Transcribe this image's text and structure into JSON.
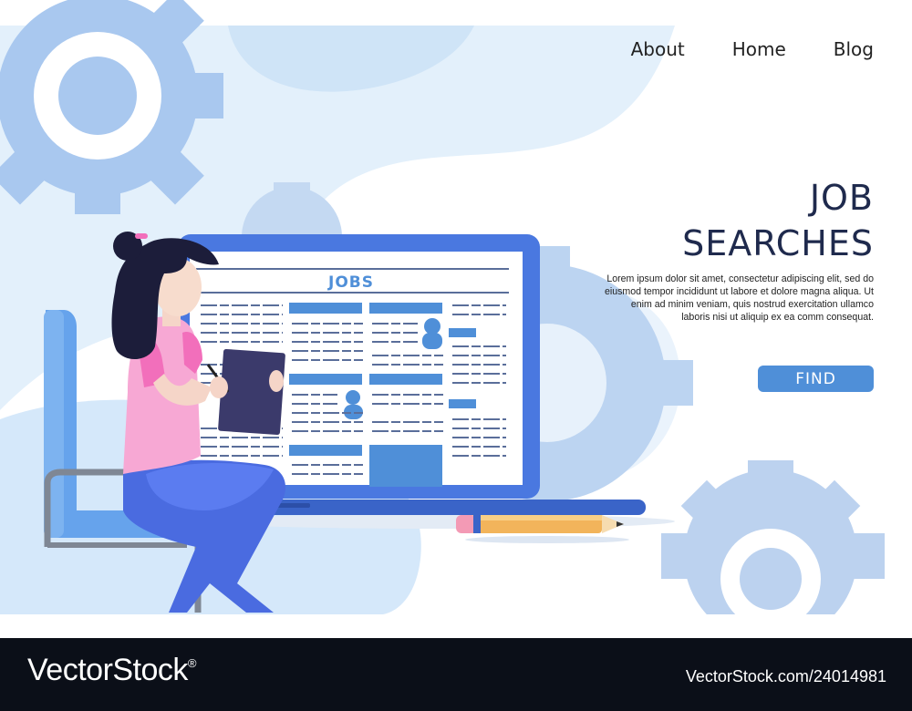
{
  "nav": {
    "items": [
      "About",
      "Home",
      "Blog"
    ]
  },
  "hero": {
    "title_line1": "JOB",
    "title_line2": "SEARCHES",
    "description": "Lorem ipsum dolor sit amet, consectetur adipiscing elit, sed do eiusmod tempor incididunt ut labore et dolore magna aliqua. Ut enim ad minim veniam, quis nostrud exercitation ullamco laboris nisi ut aliquip ex ea comm consequat.",
    "button": "FIND"
  },
  "laptop": {
    "newspaper_title": "JOBS"
  },
  "watermark": {
    "logo": "VectorStock",
    "registered": "®",
    "id": "VectorStock.com/24014981"
  },
  "colors": {
    "accent": "#4f8fd8",
    "title": "#1f2a4d",
    "footer": "#0b0f18"
  }
}
